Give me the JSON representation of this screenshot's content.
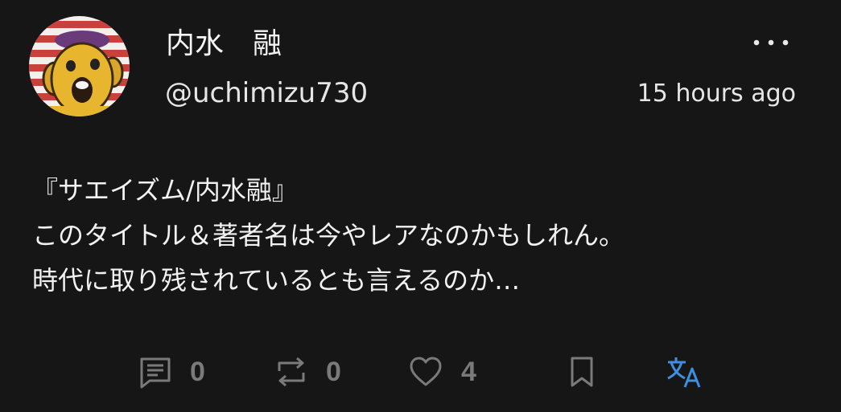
{
  "author": {
    "display_name": "内水　融",
    "handle": "@uchimizu730",
    "avatar_icon": "cartoon-face-avatar"
  },
  "post": {
    "timestamp": "15 hours ago",
    "lines": [
      "『サエイズム/内水融』",
      "このタイトル＆著者名は今やレアなのかもしれん。",
      "時代に取り残されているとも言えるのか…"
    ]
  },
  "actions": {
    "reply": {
      "icon": "comment-icon",
      "count": "0"
    },
    "repost": {
      "icon": "repost-icon",
      "count": "0"
    },
    "like": {
      "icon": "heart-icon",
      "count": "4"
    },
    "bookmark": {
      "icon": "bookmark-icon"
    },
    "translate": {
      "icon": "translate-icon"
    }
  },
  "colors": {
    "background": "#161616",
    "text": "#f2f2f2",
    "muted": "#7a7a7a",
    "accent": "#3d8fe0"
  }
}
